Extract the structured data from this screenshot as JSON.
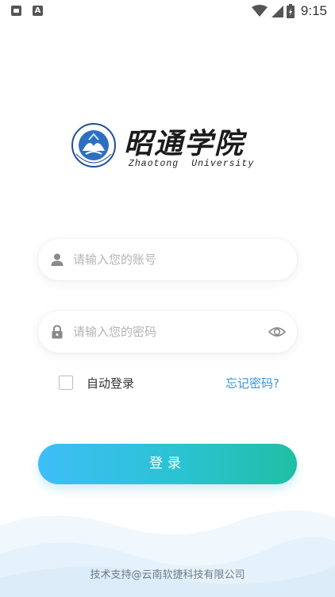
{
  "status_bar": {
    "time": "9:15",
    "left_icons": [
      "cat-notification-icon",
      "a-notification-icon"
    ],
    "right_icons": [
      "wifi-icon",
      "signal-icon",
      "battery-charging-icon"
    ]
  },
  "logo": {
    "name_cn": "昭通学院",
    "name_en_1": "Zhaotong",
    "name_en_2": "University",
    "emblem_text": "ZHAOTONG UNIVERSITY"
  },
  "account": {
    "placeholder": "请输入您的账号",
    "value": "",
    "icon": "user-icon"
  },
  "password": {
    "placeholder": "请输入您的密码",
    "value": "",
    "icon": "lock-icon",
    "toggle_icon": "eye-icon"
  },
  "options": {
    "auto_login_label": "自动登录",
    "auto_login_checked": false,
    "forgot_label": "忘记密码?"
  },
  "login_button": {
    "label": "登录"
  },
  "footer": {
    "text": "技术支持@云南软捷科技有限公司"
  },
  "colors": {
    "accent_link": "#3b94d6",
    "button_start": "#3ebef8",
    "button_end": "#1fbfa4",
    "wave": "#e8f3fb"
  }
}
